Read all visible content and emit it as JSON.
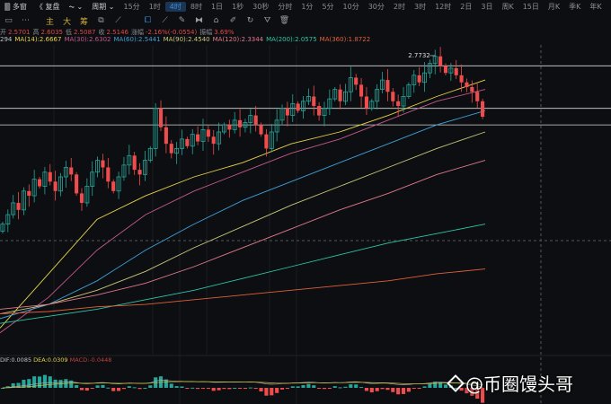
{
  "topbar": {
    "items": [
      "🀫 多窗",
      "《 复盘",
      "⏦ ⌄",
      "周期 ⌄",
      "15分",
      "1时",
      "4时",
      "8时",
      "1日",
      "1秒",
      "30秒",
      "分时",
      "1分",
      "5分",
      "10分",
      "30分",
      "2时",
      "3时",
      "12时",
      "2日",
      "3日",
      "周K",
      "15日",
      "月K",
      "季K",
      "年K"
    ],
    "active": "4时"
  },
  "toolbar": {
    "items": [
      {
        "icon": "rect-icon",
        "g": "▭"
      },
      {
        "icon": "more-icon",
        "g": "⋯"
      },
      {
        "icon": "main-indicator",
        "g": "主"
      },
      {
        "icon": "large-indicator",
        "g": "大"
      },
      {
        "icon": "chip-indicator",
        "g": "筹"
      },
      {
        "icon": "copy-icon",
        "g": "⧉"
      },
      {
        "icon": "line-tool-icon",
        "g": "⟋"
      },
      {
        "icon": "select-tool-icon",
        "g": "⧠"
      },
      {
        "icon": "ruler-icon",
        "g": "⟋"
      },
      {
        "icon": "pen-icon",
        "g": "✎"
      },
      {
        "icon": "pattern-icon",
        "g": "⧓"
      },
      {
        "icon": "lock-icon",
        "g": "⌂"
      },
      {
        "icon": "note-icon",
        "g": "✐"
      },
      {
        "icon": "magnet-icon",
        "g": "↻"
      },
      {
        "icon": "filter-icon",
        "g": "⛛"
      },
      {
        "icon": "trash-icon",
        "g": "🗑"
      }
    ]
  },
  "ohlc": [
    [
      "开",
      "2.5701"
    ],
    [
      "高",
      "2.6035"
    ],
    [
      "低",
      "2.5087"
    ],
    [
      "收",
      "2.5146"
    ],
    [
      "涨幅",
      "-2.16%(-0.0554)"
    ],
    [
      "振幅",
      "3.69%"
    ]
  ],
  "ma_labels": [
    {
      "t": "294",
      "c": "#c0c2c6"
    },
    {
      "t": "MA(14):2.6667",
      "c": "#e6d24a"
    },
    {
      "t": "MA(30):2.6302",
      "c": "#c05a8a"
    },
    {
      "t": "MA(60):2.5441",
      "c": "#3ea0d8"
    },
    {
      "t": "MA(90):2.4540",
      "c": "#c9c77a"
    },
    {
      "t": "MA(120):2.3344",
      "c": "#e07a8a"
    },
    {
      "t": "MA(200):2.0575",
      "c": "#2cc6a8"
    },
    {
      "t": "MA(360):1.8722",
      "c": "#e0603a"
    }
  ],
  "high_label": "2.7732",
  "colors": {
    "up": "#26a69a",
    "down": "#ef4d4d"
  },
  "chart_data": {
    "type": "candlestick",
    "last_close": 2.5146,
    "high": 2.7732,
    "closes": [
      2.06,
      2.1,
      2.15,
      2.12,
      2.2,
      2.18,
      2.25,
      2.22,
      2.28,
      2.24,
      2.2,
      2.26,
      2.3,
      2.27,
      2.19,
      2.15,
      2.22,
      2.28,
      2.33,
      2.3,
      2.24,
      2.2,
      2.26,
      2.31,
      2.35,
      2.29,
      2.27,
      2.33,
      2.38,
      2.55,
      2.47,
      2.4,
      2.36,
      2.38,
      2.42,
      2.39,
      2.44,
      2.41,
      2.46,
      2.43,
      2.4,
      2.45,
      2.48,
      2.46,
      2.5,
      2.47,
      2.49,
      2.52,
      2.48,
      2.44,
      2.38,
      2.45,
      2.5,
      2.55,
      2.52,
      2.57,
      2.54,
      2.58,
      2.6,
      2.56,
      2.52,
      2.55,
      2.59,
      2.63,
      2.58,
      2.62,
      2.68,
      2.65,
      2.6,
      2.55,
      2.58,
      2.63,
      2.67,
      2.62,
      2.58,
      2.56,
      2.6,
      2.65,
      2.69,
      2.66,
      2.7,
      2.74,
      2.77,
      2.73,
      2.7,
      2.72,
      2.69,
      2.66,
      2.64,
      2.62,
      2.58,
      2.5146
    ],
    "ma_lines": [
      {
        "name": "MA14",
        "color": "#e6d24a",
        "v": [
          1.62,
          1.85,
          2.08,
          2.18,
          2.26,
          2.32,
          2.4,
          2.45,
          2.52,
          2.6,
          2.67
        ]
      },
      {
        "name": "MA30",
        "color": "#c05a8a",
        "v": [
          1.6,
          1.75,
          1.95,
          2.1,
          2.2,
          2.28,
          2.36,
          2.42,
          2.5,
          2.58,
          2.63
        ]
      },
      {
        "name": "MA60",
        "color": "#3ea0d8",
        "v": [
          1.66,
          1.72,
          1.82,
          1.95,
          2.06,
          2.16,
          2.24,
          2.32,
          2.4,
          2.48,
          2.54
        ]
      },
      {
        "name": "MA90",
        "color": "#c9c77a",
        "v": [
          1.68,
          1.72,
          1.78,
          1.86,
          1.96,
          2.05,
          2.14,
          2.22,
          2.3,
          2.38,
          2.45
        ]
      },
      {
        "name": "MA120",
        "color": "#e07a8a",
        "v": [
          1.7,
          1.72,
          1.76,
          1.81,
          1.88,
          1.96,
          2.04,
          2.12,
          2.19,
          2.27,
          2.33
        ]
      },
      {
        "name": "MA200",
        "color": "#2cc6a8",
        "v": [
          1.64,
          1.67,
          1.7,
          1.74,
          1.78,
          1.83,
          1.88,
          1.93,
          1.98,
          2.02,
          2.06
        ]
      },
      {
        "name": "MA360",
        "color": "#e0603a",
        "v": [
          1.68,
          1.69,
          1.71,
          1.72,
          1.74,
          1.76,
          1.78,
          1.8,
          1.82,
          1.85,
          1.87
        ]
      }
    ],
    "hlines": [
      2.73,
      2.55,
      2.48
    ]
  },
  "macd": {
    "dif": "DIF:0.0085",
    "dea": "DEA:0.0309",
    "macd": "MACD:-0.0448"
  },
  "watermark": "@币圈馒头哥"
}
